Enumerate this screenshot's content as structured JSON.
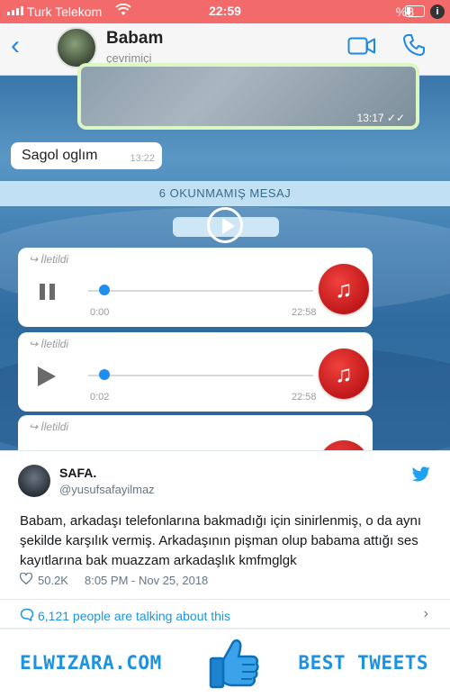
{
  "phone": {
    "status": {
      "carrier": "Turk Telekom",
      "time": "22:59",
      "battery": "%8"
    },
    "header": {
      "contact_name": "Babam",
      "presence": "çevrimiçi"
    },
    "image_message": {
      "time": "13:17"
    },
    "incoming_message": {
      "text": "Sagol oglım",
      "time": "13:22"
    },
    "unread_banner": "6 OKUNMAMIŞ MESAJ",
    "voice_messages": [
      {
        "forwarded": "İletildi",
        "state": "paused",
        "elapsed": "0:00",
        "duration": "22:58"
      },
      {
        "forwarded": "İletildi",
        "state": "stopped",
        "elapsed": "0:02",
        "duration": "22:58"
      },
      {
        "forwarded": "İletildi"
      }
    ]
  },
  "tweet": {
    "display_name": "SAFA.",
    "handle": "@yusufsafayilmaz",
    "text": "Babam, arkadaşı telefonlarına bakmadığı için sinirlenmiş, o da aynı şekilde karşılık vermiş. Arkadaşının pişman olup babama attığı ses kayıtlarına bak muazzam arkadaşlık kmfmglgk",
    "likes": "50.2K",
    "timestamp": "8:05 PM - Nov 25, 2018",
    "talking": "6,121 people are talking about this"
  },
  "footer": {
    "site": "ELWIZARA.COM",
    "tagline": "BEST TWEETS"
  },
  "colors": {
    "status_bar": "#f26a6a",
    "ios_blue": "#1e88e5",
    "twitter_blue": "#1b95e0",
    "music_red": "#d8231f"
  }
}
